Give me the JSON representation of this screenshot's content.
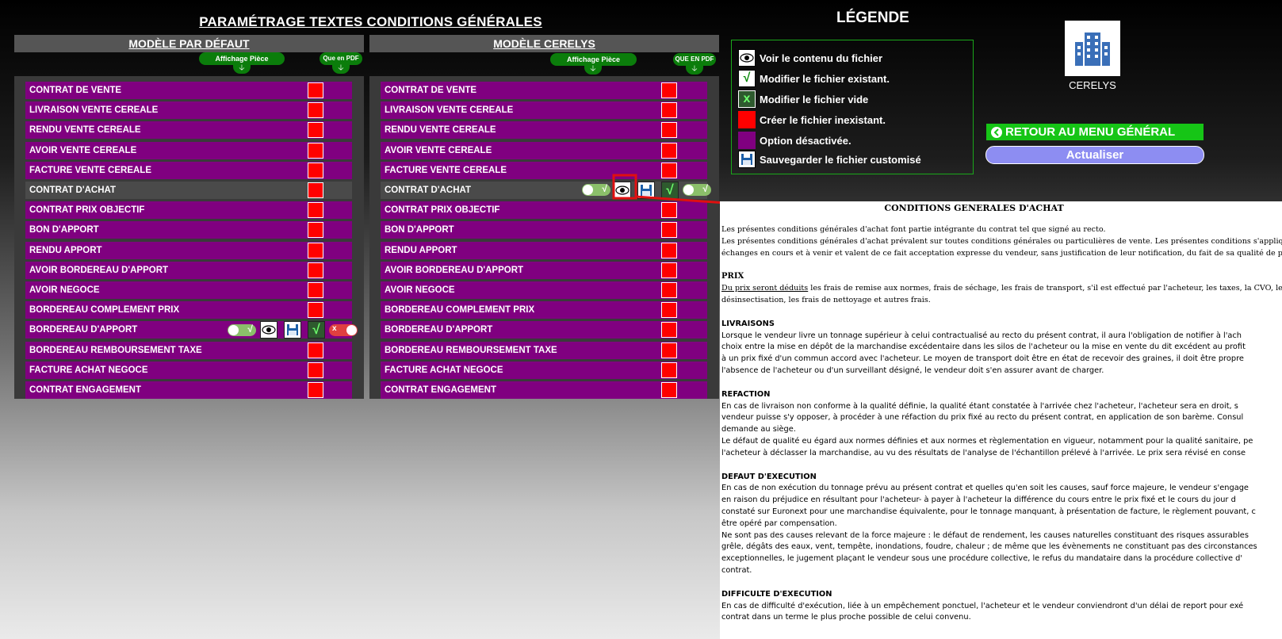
{
  "page_title": "PARAMÉTRAGE TEXTES CONDITIONS GÉNÉRALES",
  "legend_title": "LÉGENDE",
  "panels": {
    "default": {
      "title": "MODÈLE PAR DÉFAUT",
      "affichage_label": "Affichage Pièce",
      "pdf_label": "Que en PDF"
    },
    "cerelys": {
      "title": "MODÈLE CERELYS",
      "affichage_label": "Affichage Pièce",
      "pdf_label": "QUE EN PDF"
    }
  },
  "rows": [
    "CONTRAT DE VENTE",
    "LIVRAISON VENTE CEREALE",
    "RENDU VENTE CEREALE",
    "AVOIR VENTE CEREALE",
    "FACTURE VENTE CEREALE",
    "CONTRAT D'ACHAT",
    "CONTRAT PRIX OBJECTIF",
    "BON D'APPORT",
    "RENDU APPORT",
    "AVOIR BORDEREAU D'APPORT",
    "AVOIR NEGOCE",
    "BORDEREAU COMPLEMENT PRIX",
    "BORDEREAU D'APPORT",
    "BORDEREAU REMBOURSEMENT TAXE",
    "FACTURE ACHAT NEGOCE",
    "CONTRAT ENGAGEMENT"
  ],
  "legend": {
    "view": "Voir le contenu du fichier",
    "modify_existing": "Modifier le fichier existant.",
    "modify_empty": "Modifier le fichier vide",
    "create": "Créer le fichier inexistant.",
    "disabled": "Option désactivée.",
    "save": "Sauvegarder le fichier customisé"
  },
  "buttons": {
    "back": "RETOUR AU MENU GÉNÉRAL",
    "refresh": "Actualiser"
  },
  "logo_name": "CERELYS",
  "icons": {
    "check": "√",
    "x": "x",
    "down": "🡣"
  },
  "colors": {
    "row": "#800080",
    "create": "#ff0000",
    "accent_green": "#16c516",
    "refresh": "#8d8df2"
  },
  "document": {
    "title": "CONDITIONS GENERALES D'ACHAT",
    "intro": [
      "Les présentes conditions générales d'achat font partie intégrante du contrat tel que signé au recto.",
      "Les présentes conditions générales d'achat prévalent sur toutes conditions générales ou particulières de vente. Les présentes conditions s'appliquent à",
      "échanges en cours et à venir et valent de ce fait acceptation expresse du vendeur, sans justification de leur notification, du fait de sa qualité de profes"
    ],
    "prix_h": "PRIX",
    "prix_u": "Du prix seront déduits",
    "prix": [
      " les frais de remise aux normes, frais de séchage, les frais de transport, s'il est effectué par l'acheteur, les taxes, la CVO, les frai",
      "désinsectisation, les frais de nettoyage et autres frais."
    ],
    "livraisons_h": "LIVRAISONS",
    "livraisons": [
      "Lorsque le vendeur livre un tonnage supérieur à celui contractualisé au recto du présent contrat, il aura l'obligation de notifier à l'ach",
      "choix entre la mise en dépôt de la marchandise excédentaire dans les silos de l'acheteur ou la mise en vente du dit excédent au profit",
      "à un prix fixé d'un commun accord avec l'acheteur. Le moyen de transport doit être en état de recevoir des graines, il doit être propre",
      "l'absence de l'acheteur ou d'un surveillant désigné, le vendeur doit s'en assurer avant de charger."
    ],
    "refaction_h": "REFACTION",
    "refaction": [
      "En cas de livraison non conforme à la qualité définie, la qualité étant constatée à l'arrivée chez l'acheteur, l'acheteur sera en droit, s",
      "vendeur puisse s'y opposer, à procéder à une réfaction du prix fixé au recto du présent contrat, en application de son barème. Consul",
      "demande au siège.",
      "Le défaut de qualité eu égard aux normes définies et aux normes et règlementation en vigueur, notamment pour la qualité sanitaire, pe",
      "l'acheteur à déclasser la marchandise, au vu des résultats de l'analyse de l'échantillon prélevé à l'arrivée. Le prix sera révisé en conse"
    ],
    "defaut_h": "DEFAUT D'EXECUTION",
    "defaut": [
      "En cas de non exécution du tonnage prévu au présent contrat et quelles qu'en soit les causes, sauf force majeure, le vendeur s'engage",
      "en raison du préjudice en résultant pour l'acheteur- à payer à l'acheteur la différence du cours entre le prix fixé et le cours du jour d",
      "constaté sur Euronext pour une marchandise équivalente, pour le tonnage manquant, à présentation de facture, le règlement pouvant, c",
      "être opéré par compensation.",
      "Ne sont pas des causes relevant de la force majeure : le défaut de rendement, les causes naturelles constituant des risques assurables",
      "grêle, dégâts des eaux, vent, tempête, inondations, foudre, chaleur ; de même que les évènements ne constituant pas des circonstances",
      "exceptionnelles, le jugement plaçant le vendeur  sous une procédure collective, le refus du mandataire dans la procédure collective d'",
      "contrat."
    ],
    "difficulte_h": "DIFFICULTE D'EXECUTION",
    "difficulte": [
      "En cas de difficulté d'exécution, liée à un empêchement ponctuel, l'acheteur et le vendeur conviendront d'un délai de report pour exé",
      "contrat dans un terme le plus proche possible de celui convenu."
    ]
  }
}
